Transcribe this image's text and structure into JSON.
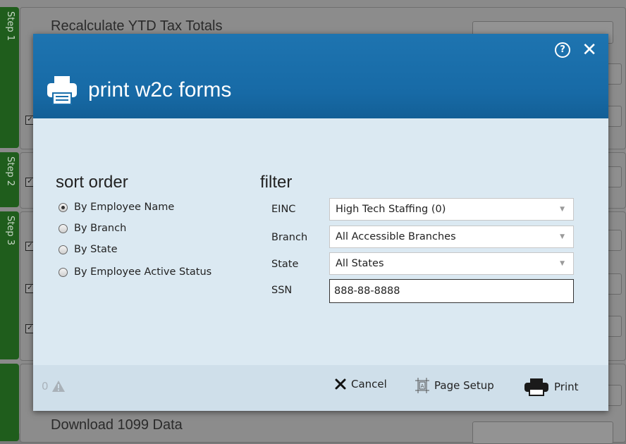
{
  "background": {
    "top_item": "Recalculate YTD Tax Totals",
    "bottom_item": "Download 1099 Data",
    "step_labels": [
      "Step 1",
      "Step 2",
      "Step 3"
    ]
  },
  "modal": {
    "title": "print w2c forms",
    "help_label": "?",
    "close_label": "✕"
  },
  "sort_order": {
    "title": "sort order",
    "selected_index": 0,
    "options": [
      "By Employee Name",
      "By Branch",
      "By State",
      "By Employee Active Status"
    ]
  },
  "filter": {
    "title": "filter",
    "einc": {
      "label": "EINC",
      "value": "High Tech Staffing (0)"
    },
    "branch": {
      "label": "Branch",
      "value": "All Accessible Branches"
    },
    "state": {
      "label": "State",
      "value": "All States"
    },
    "ssn": {
      "label": "SSN",
      "value": "888-88-8888"
    }
  },
  "footer": {
    "warning_count": "0",
    "cancel_label": "Cancel",
    "page_setup_label": "Page Setup",
    "print_label": "Print"
  },
  "colors": {
    "header": "#1e74b0",
    "body": "#dbe9f2",
    "footer": "#cfdfea",
    "step_bar": "#1f5d1c"
  }
}
